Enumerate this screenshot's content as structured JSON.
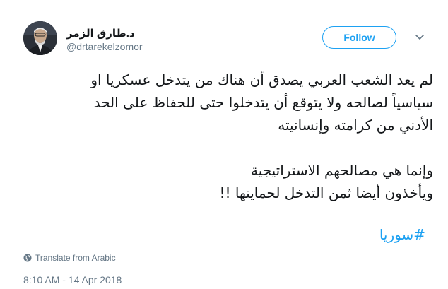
{
  "author": {
    "display_name": "د.طارق الزمر",
    "handle": "@drtarekelzomor"
  },
  "follow_button": {
    "label": "Follow"
  },
  "tweet": {
    "lines": [
      "لم يعد الشعب العربي يصدق أن هناك من يتدخل عسكريا او",
      "سياسياً لصالحه ولا يتوقع أن يتدخلوا حتى للحفاظ على الحد",
      "الأدني من كرامته وإنسانيته",
      "وإنما هي مصالحهم الاستراتيجية",
      "ويأخذون أيضا ثمن التدخل لحمايتها !!"
    ],
    "hashtag": "#سوريا"
  },
  "translate": {
    "label": "Translate from Arabic",
    "icon": "globe-icon"
  },
  "timestamp": "8:10 AM - 14 Apr 2018",
  "colors": {
    "accent": "#1da1f2",
    "secondary_text": "#657786",
    "primary_text": "#14171a"
  }
}
